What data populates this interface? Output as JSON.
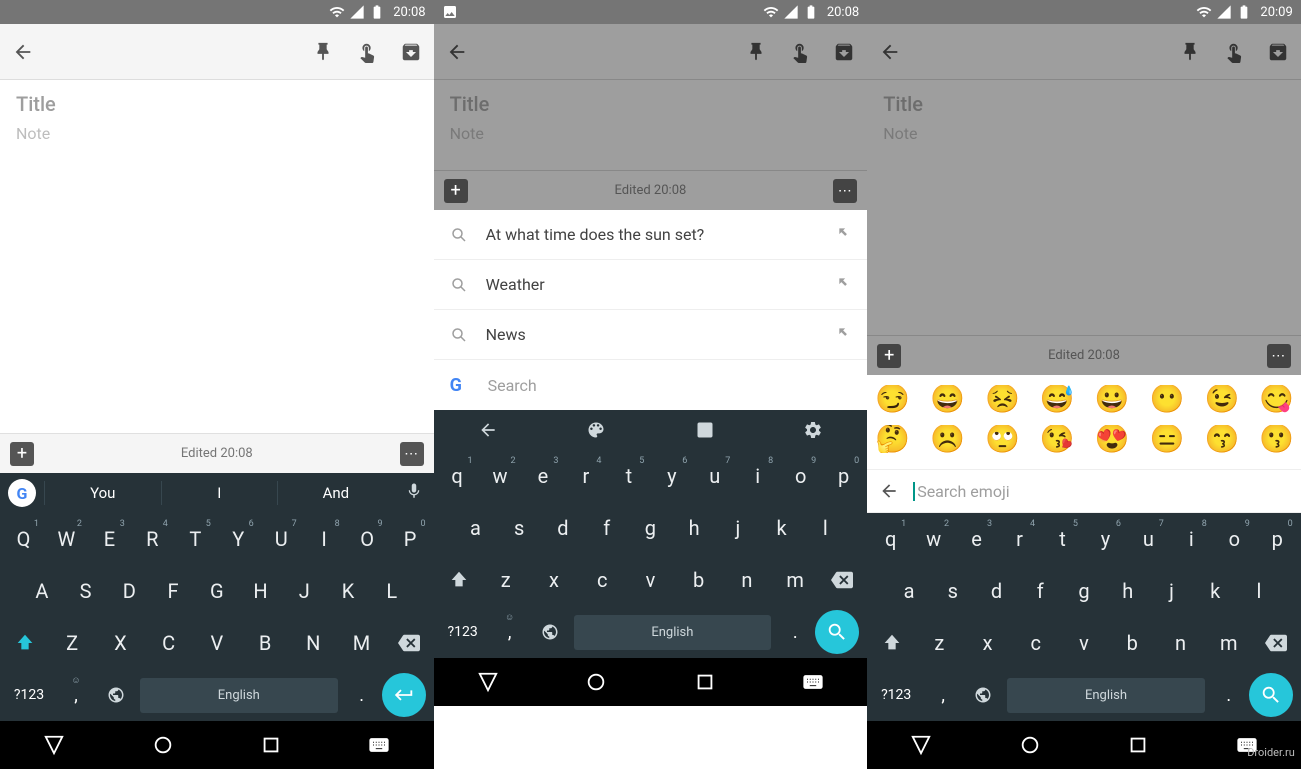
{
  "watermark": "Droider.ru",
  "panels": [
    {
      "status_time": "20:08",
      "title_placeholder": "Title",
      "note_placeholder": "Note",
      "edited": "Edited 20:08",
      "suggestions": [
        "You",
        "I",
        "And"
      ],
      "row1": [
        "Q",
        "W",
        "E",
        "R",
        "T",
        "Y",
        "U",
        "I",
        "O",
        "P"
      ],
      "row1_sup": [
        "1",
        "2",
        "3",
        "4",
        "5",
        "6",
        "7",
        "8",
        "9",
        "0"
      ],
      "row2": [
        "A",
        "S",
        "D",
        "F",
        "G",
        "H",
        "J",
        "K",
        "L"
      ],
      "row3": [
        "Z",
        "X",
        "C",
        "V",
        "B",
        "N",
        "M"
      ],
      "sym": "?123",
      "space": "English",
      "dot": "."
    },
    {
      "status_time": "20:08",
      "title_placeholder": "Title",
      "note_placeholder": "Note",
      "edited": "Edited 20:08",
      "search_rows": [
        "At what time does the sun set?",
        "Weather",
        "News"
      ],
      "search_label": "Search",
      "row1": [
        "q",
        "w",
        "e",
        "r",
        "t",
        "y",
        "u",
        "i",
        "o",
        "p"
      ],
      "row1_sup": [
        "1",
        "2",
        "3",
        "4",
        "5",
        "6",
        "7",
        "8",
        "9",
        "0"
      ],
      "row2": [
        "a",
        "s",
        "d",
        "f",
        "g",
        "h",
        "j",
        "k",
        "l"
      ],
      "row3": [
        "z",
        "x",
        "c",
        "v",
        "b",
        "n",
        "m"
      ],
      "sym": "?123",
      "space": "English",
      "dot": "."
    },
    {
      "status_time": "20:09",
      "title_placeholder": "Title",
      "note_placeholder": "Note",
      "edited": "Edited 20:08",
      "emoji_row1": [
        "😏",
        "😄",
        "😣",
        "😅",
        "😀",
        "😶",
        "😉",
        "😋"
      ],
      "emoji_row2": [
        "🤔",
        "☹️",
        "🙄",
        "😘",
        "😍",
        "😑",
        "😙",
        "😗"
      ],
      "emoji_search_placeholder": "Search emoji",
      "row1": [
        "q",
        "w",
        "e",
        "r",
        "t",
        "y",
        "u",
        "i",
        "o",
        "p"
      ],
      "row1_sup": [
        "1",
        "2",
        "3",
        "4",
        "5",
        "6",
        "7",
        "8",
        "9",
        "0"
      ],
      "row2": [
        "a",
        "s",
        "d",
        "f",
        "g",
        "h",
        "j",
        "k",
        "l"
      ],
      "row3": [
        "z",
        "x",
        "c",
        "v",
        "b",
        "n",
        "m"
      ],
      "sym": "?123",
      "comma": ",",
      "space": "English",
      "dot": "."
    }
  ]
}
